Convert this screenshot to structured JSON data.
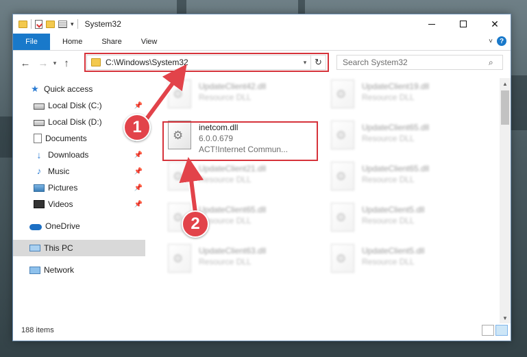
{
  "window": {
    "title": "System32",
    "controls": {
      "minimize": "",
      "maximize": "",
      "close": "✕"
    }
  },
  "ribbon": {
    "tabs": [
      "File",
      "Home",
      "Share",
      "View"
    ],
    "help": "?"
  },
  "address": {
    "path": "C:\\Windows\\System32",
    "search_placeholder": "Search System32"
  },
  "nav": {
    "items": [
      {
        "label": "Quick access",
        "icon": "star-icon"
      },
      {
        "label": "Local Disk (C:)",
        "icon": "disk-icon",
        "pinned": true
      },
      {
        "label": "Local Disk (D:)",
        "icon": "disk-icon",
        "pinned": false
      },
      {
        "label": "Documents",
        "icon": "documents-icon",
        "pinned": true
      },
      {
        "label": "Downloads",
        "icon": "download-icon",
        "pinned": true
      },
      {
        "label": "Music",
        "icon": "music-icon",
        "pinned": true
      },
      {
        "label": "Pictures",
        "icon": "pictures-icon",
        "pinned": true
      },
      {
        "label": "Videos",
        "icon": "videos-icon",
        "pinned": true
      },
      {
        "label": "OneDrive",
        "icon": "onedrive-icon"
      },
      {
        "label": "This PC",
        "icon": "this-pc-icon",
        "selected": true
      },
      {
        "label": "Network",
        "icon": "network-icon"
      }
    ]
  },
  "files": {
    "left": [
      {
        "name": "UpdateClient42.dll",
        "sub": "Resource DLL"
      },
      {
        "name": "inetcom.dll",
        "version": "6.0.0.679",
        "description": "ACT!Internet Commun...",
        "highlighted": true
      },
      {
        "name": "UpdateClient21.dll",
        "sub": "Resource DLL"
      },
      {
        "name": "UpdateClient65.dll",
        "sub": "Resource DLL"
      },
      {
        "name": "UpdateClient63.dll",
        "sub": "Resource DLL"
      }
    ],
    "right": [
      {
        "name": "UpdateClient19.dll",
        "sub": "Resource DLL"
      },
      {
        "name": "UpdateClient65.dll",
        "sub": "Resource DLL"
      },
      {
        "name": "UpdateClient65.dll",
        "sub": "Resource DLL"
      },
      {
        "name": "UpdateClient5.dll",
        "sub": "Resource DLL"
      },
      {
        "name": "UpdateClient5.dll",
        "sub": "Resource DLL"
      }
    ]
  },
  "status": {
    "item_count": "188 items"
  },
  "annotations": {
    "step1": "1",
    "step2": "2",
    "color": "#e2434a",
    "highlight_color": "#d6323a"
  }
}
